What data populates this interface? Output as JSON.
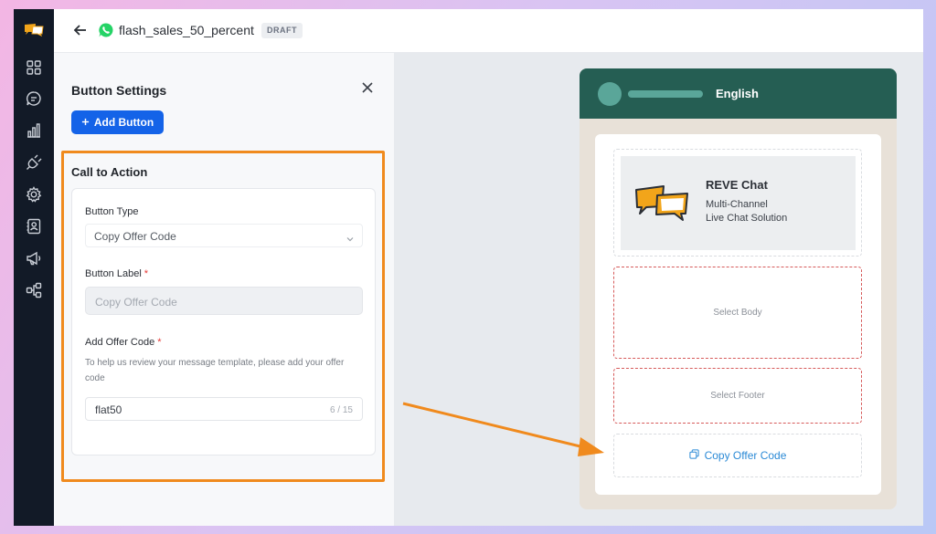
{
  "header": {
    "template_name": "flash_sales_50_percent",
    "status_badge": "DRAFT"
  },
  "panel": {
    "title": "Button Settings",
    "add_button_label": "Add Button",
    "section_title": "Call to Action",
    "button_type": {
      "label": "Button Type",
      "value": "Copy Offer Code"
    },
    "button_label": {
      "label": "Button Label",
      "required_mark": "*",
      "placeholder": "Copy Offer Code"
    },
    "offer_code": {
      "label": "Add Offer Code",
      "required_mark": "*",
      "helper": "To help us review your message template, please add your offer code",
      "value": "flat50",
      "counter": "6 / 15"
    }
  },
  "preview": {
    "language": "English",
    "brand_title": "REVE Chat",
    "brand_line1": "Multi-Channel",
    "brand_line2": "Live Chat Solution",
    "body_placeholder": "Select Body",
    "footer_placeholder": "Select Footer",
    "cta_button": "Copy Offer Code"
  },
  "colors": {
    "rail": "#121a27",
    "primary": "#1463e8",
    "highlight": "#f08a1d",
    "whatsapp_header": "#255e53",
    "link": "#2b8ad6"
  },
  "icons": {
    "rail": [
      "logo-icon",
      "grid-icon",
      "chat-icon",
      "chart-icon",
      "plug-icon",
      "gear-icon",
      "contacts-icon",
      "megaphone-icon",
      "flow-icon"
    ],
    "header": [
      "back-arrow-icon",
      "whatsapp-icon"
    ]
  }
}
